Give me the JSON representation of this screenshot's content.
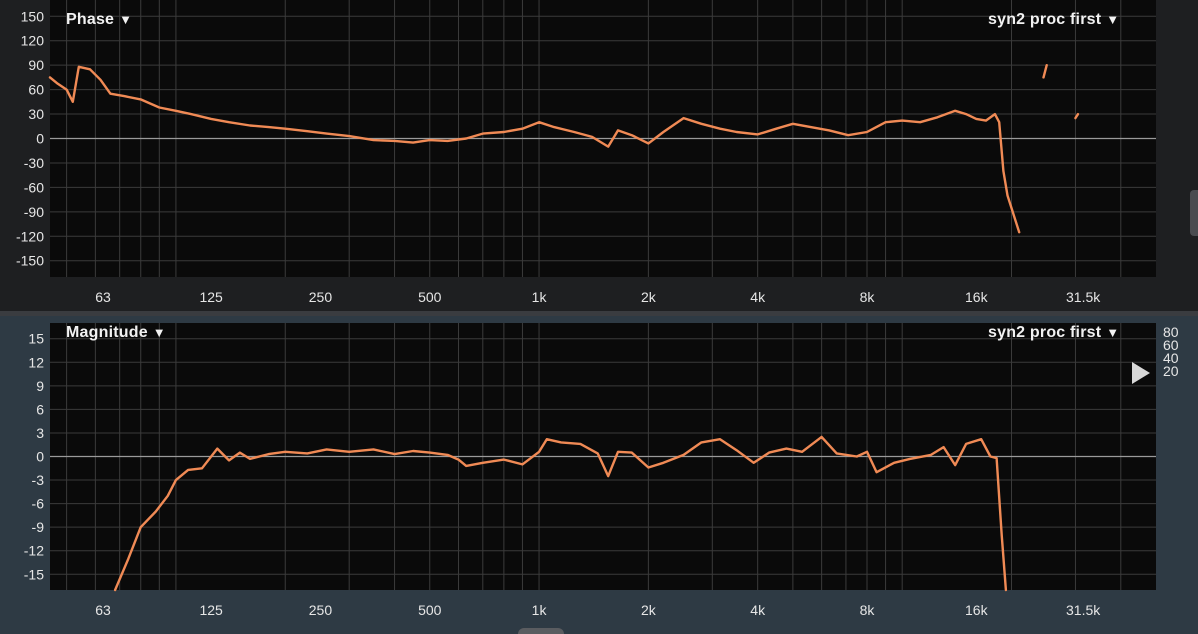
{
  "phase": {
    "title": "Phase",
    "source_label": "syn2 proc first",
    "y_ticks": [
      "150",
      "120",
      "90",
      "60",
      "30",
      "0",
      "-30",
      "-60",
      "-90",
      "-120",
      "-150"
    ],
    "x_ticks": [
      "63",
      "125",
      "250",
      "500",
      "1k",
      "2k",
      "4k",
      "8k",
      "16k",
      "31.5k"
    ]
  },
  "magnitude": {
    "title": "Magnitude",
    "source_label": "syn2 proc first",
    "y_ticks": [
      "15",
      "12",
      "9",
      "6",
      "3",
      "0",
      "-3",
      "-6",
      "-9",
      "-12",
      "-15"
    ],
    "x_ticks": [
      "63",
      "125",
      "250",
      "500",
      "1k",
      "2k",
      "4k",
      "8k",
      "16k",
      "31.5k"
    ],
    "scale_labels": [
      "80",
      "60",
      "40",
      "20"
    ]
  },
  "dropdown_arrow": "▼",
  "colors": {
    "curve": "#f08a55",
    "plot_bg": "#0a0a0a",
    "grid": "#3b3b3b"
  },
  "chart_data": [
    {
      "type": "line",
      "title": "Phase",
      "xlabel": "",
      "ylabel": "",
      "x_scale": "log",
      "xlim": [
        45,
        50000
      ],
      "ylim": [
        -170,
        170
      ],
      "grid": true,
      "series": [
        {
          "name": "syn2 proc first",
          "segments": [
            [
              [
                45,
                75
              ],
              [
                47,
                68
              ],
              [
                50,
                60
              ],
              [
                52,
                45
              ],
              [
                54,
                88
              ],
              [
                58,
                85
              ],
              [
                62,
                72
              ],
              [
                66,
                55
              ],
              [
                72,
                52
              ],
              [
                80,
                48
              ],
              [
                90,
                38
              ],
              [
                100,
                34
              ],
              [
                110,
                30
              ],
              [
                125,
                24
              ],
              [
                140,
                20
              ],
              [
                160,
                16
              ],
              [
                180,
                14
              ],
              [
                200,
                12
              ],
              [
                230,
                9
              ],
              [
                260,
                6
              ],
              [
                300,
                3
              ],
              [
                350,
                -2
              ],
              [
                400,
                -3
              ],
              [
                450,
                -5
              ],
              [
                500,
                -2
              ],
              [
                560,
                -3
              ],
              [
                630,
                0
              ],
              [
                700,
                6
              ],
              [
                800,
                8
              ],
              [
                900,
                12
              ],
              [
                1000,
                20
              ],
              [
                1100,
                14
              ],
              [
                1250,
                8
              ],
              [
                1400,
                2
              ],
              [
                1550,
                -10
              ],
              [
                1650,
                10
              ],
              [
                1800,
                4
              ],
              [
                2000,
                -6
              ],
              [
                2200,
                8
              ],
              [
                2500,
                25
              ],
              [
                2800,
                18
              ],
              [
                3150,
                12
              ],
              [
                3500,
                8
              ],
              [
                4000,
                5
              ],
              [
                4500,
                12
              ],
              [
                5000,
                18
              ],
              [
                5600,
                14
              ],
              [
                6300,
                10
              ],
              [
                7100,
                4
              ],
              [
                8000,
                8
              ],
              [
                9000,
                20
              ],
              [
                10000,
                22
              ],
              [
                11200,
                20
              ],
              [
                12500,
                26
              ],
              [
                14000,
                34
              ],
              [
                15000,
                30
              ],
              [
                16000,
                24
              ],
              [
                17000,
                22
              ],
              [
                18000,
                30
              ],
              [
                18500,
                20
              ],
              [
                19000,
                -40
              ],
              [
                19500,
                -70
              ],
              [
                21000,
                -115
              ]
            ],
            [
              [
                24500,
                75
              ],
              [
                25000,
                90
              ]
            ],
            [
              [
                30000,
                25
              ],
              [
                30500,
                30
              ]
            ]
          ]
        }
      ]
    },
    {
      "type": "line",
      "title": "Magnitude",
      "xlabel": "",
      "ylabel": "",
      "x_scale": "log",
      "xlim": [
        45,
        50000
      ],
      "ylim": [
        -17,
        17
      ],
      "grid": true,
      "series": [
        {
          "name": "syn2 proc first",
          "segments": [
            [
              [
                68,
                -17
              ],
              [
                74,
                -13
              ],
              [
                80,
                -9
              ],
              [
                88,
                -7
              ],
              [
                95,
                -5
              ],
              [
                100,
                -3
              ],
              [
                108,
                -1.7
              ],
              [
                118,
                -1.5
              ],
              [
                130,
                1
              ],
              [
                140,
                -0.5
              ],
              [
                150,
                0.5
              ],
              [
                160,
                -0.3
              ],
              [
                180,
                0.3
              ],
              [
                200,
                0.6
              ],
              [
                230,
                0.4
              ],
              [
                260,
                0.9
              ],
              [
                300,
                0.6
              ],
              [
                350,
                0.9
              ],
              [
                400,
                0.3
              ],
              [
                450,
                0.7
              ],
              [
                500,
                0.5
              ],
              [
                560,
                0.2
              ],
              [
                600,
                -0.4
              ],
              [
                630,
                -1.2
              ],
              [
                700,
                -0.8
              ],
              [
                800,
                -0.4
              ],
              [
                900,
                -1
              ],
              [
                1000,
                0.6
              ],
              [
                1050,
                2.2
              ],
              [
                1150,
                1.8
              ],
              [
                1300,
                1.6
              ],
              [
                1450,
                0.4
              ],
              [
                1550,
                -2.5
              ],
              [
                1650,
                0.6
              ],
              [
                1800,
                0.5
              ],
              [
                2000,
                -1.4
              ],
              [
                2200,
                -0.8
              ],
              [
                2500,
                0.2
              ],
              [
                2800,
                1.8
              ],
              [
                3150,
                2.2
              ],
              [
                3500,
                0.8
              ],
              [
                3900,
                -0.8
              ],
              [
                4300,
                0.5
              ],
              [
                4800,
                1
              ],
              [
                5300,
                0.6
              ],
              [
                6000,
                2.5
              ],
              [
                6600,
                0.4
              ],
              [
                7500,
                0
              ],
              [
                8000,
                0.6
              ],
              [
                8500,
                -2
              ],
              [
                9500,
                -0.8
              ],
              [
                10500,
                -0.3
              ],
              [
                12000,
                0.2
              ],
              [
                13000,
                1.2
              ],
              [
                14000,
                -1.1
              ],
              [
                15000,
                1.6
              ],
              [
                16500,
                2.2
              ],
              [
                17500,
                0
              ],
              [
                18200,
                -0.2
              ],
              [
                18800,
                -10
              ],
              [
                19300,
                -17
              ]
            ]
          ]
        }
      ]
    }
  ]
}
